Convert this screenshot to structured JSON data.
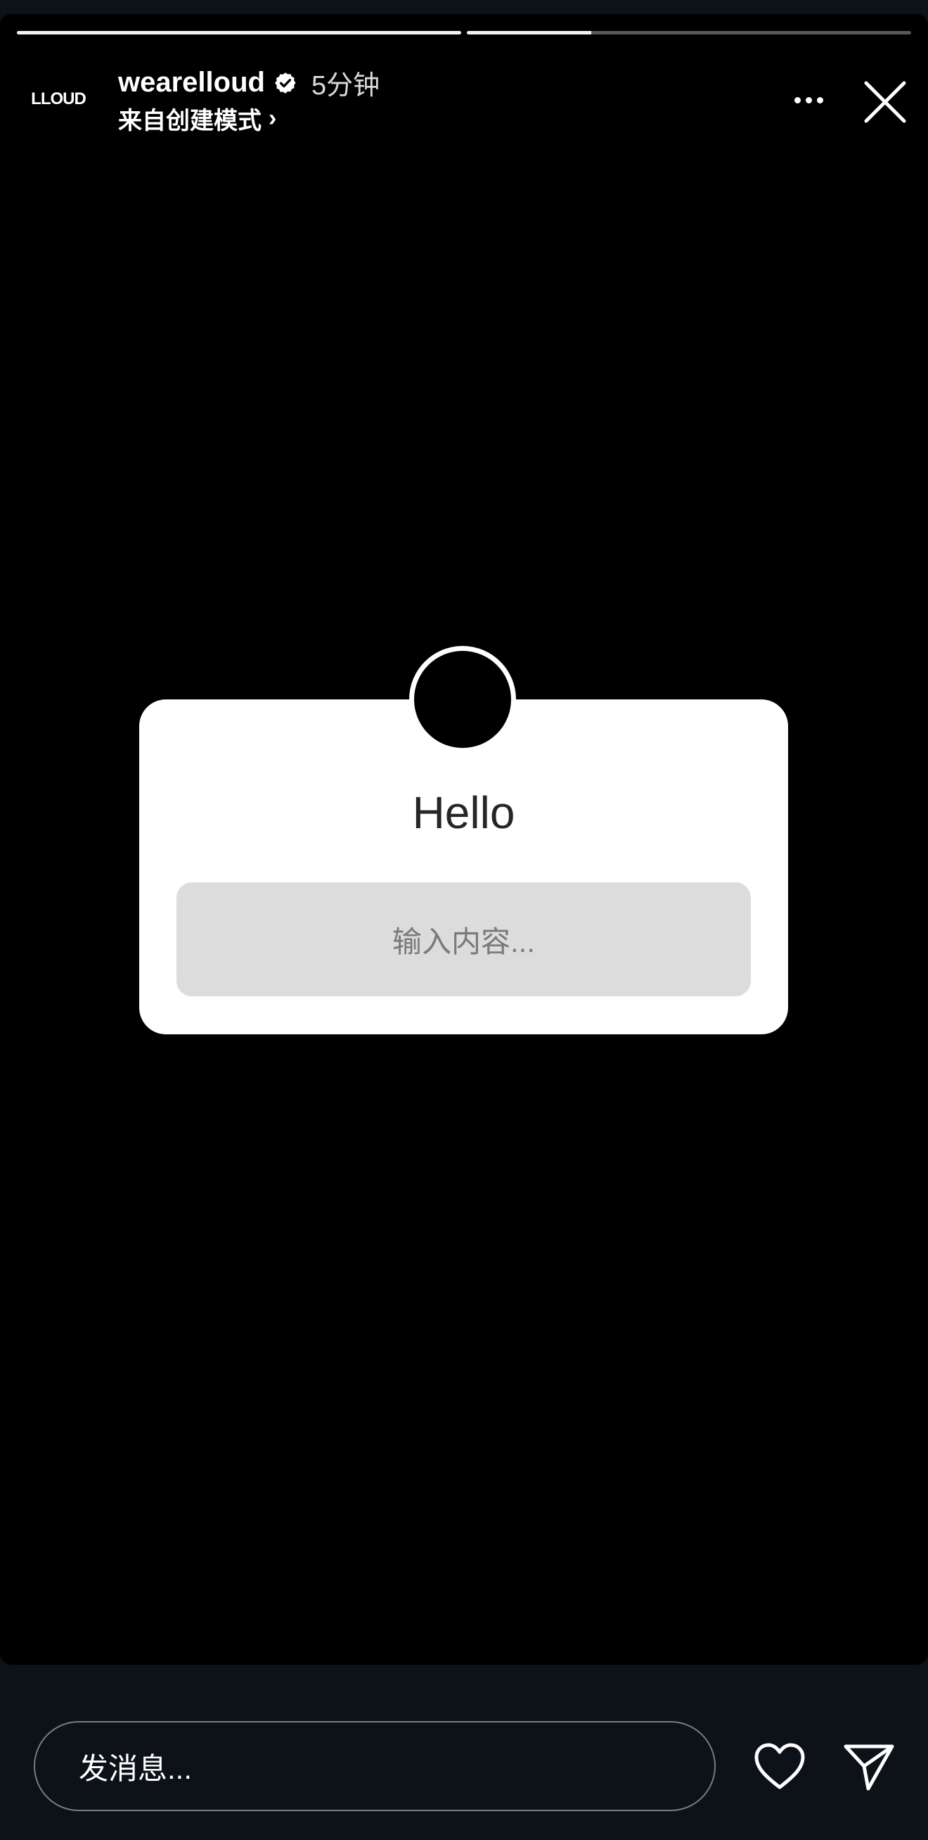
{
  "story": {
    "progress": [
      1.0,
      0.28
    ],
    "author": {
      "avatar_text": "LLOUD",
      "username": "wearelloud",
      "verified": true,
      "time": "5分钟",
      "subtitle": "来自创建模式",
      "subtitle_chevron": "›"
    },
    "actions": {
      "more_icon": "more-horizontal-icon",
      "close_icon": "close-icon"
    },
    "card": {
      "title": "Hello",
      "input_placeholder": "输入内容..."
    }
  },
  "footer": {
    "message_placeholder": "发消息...",
    "like_icon": "heart-icon",
    "send_icon": "send-icon"
  },
  "colors": {
    "background": "#0d1118",
    "story_background": "#000000",
    "card_background": "#ffffff",
    "card_input_background": "#dcdcdc"
  }
}
